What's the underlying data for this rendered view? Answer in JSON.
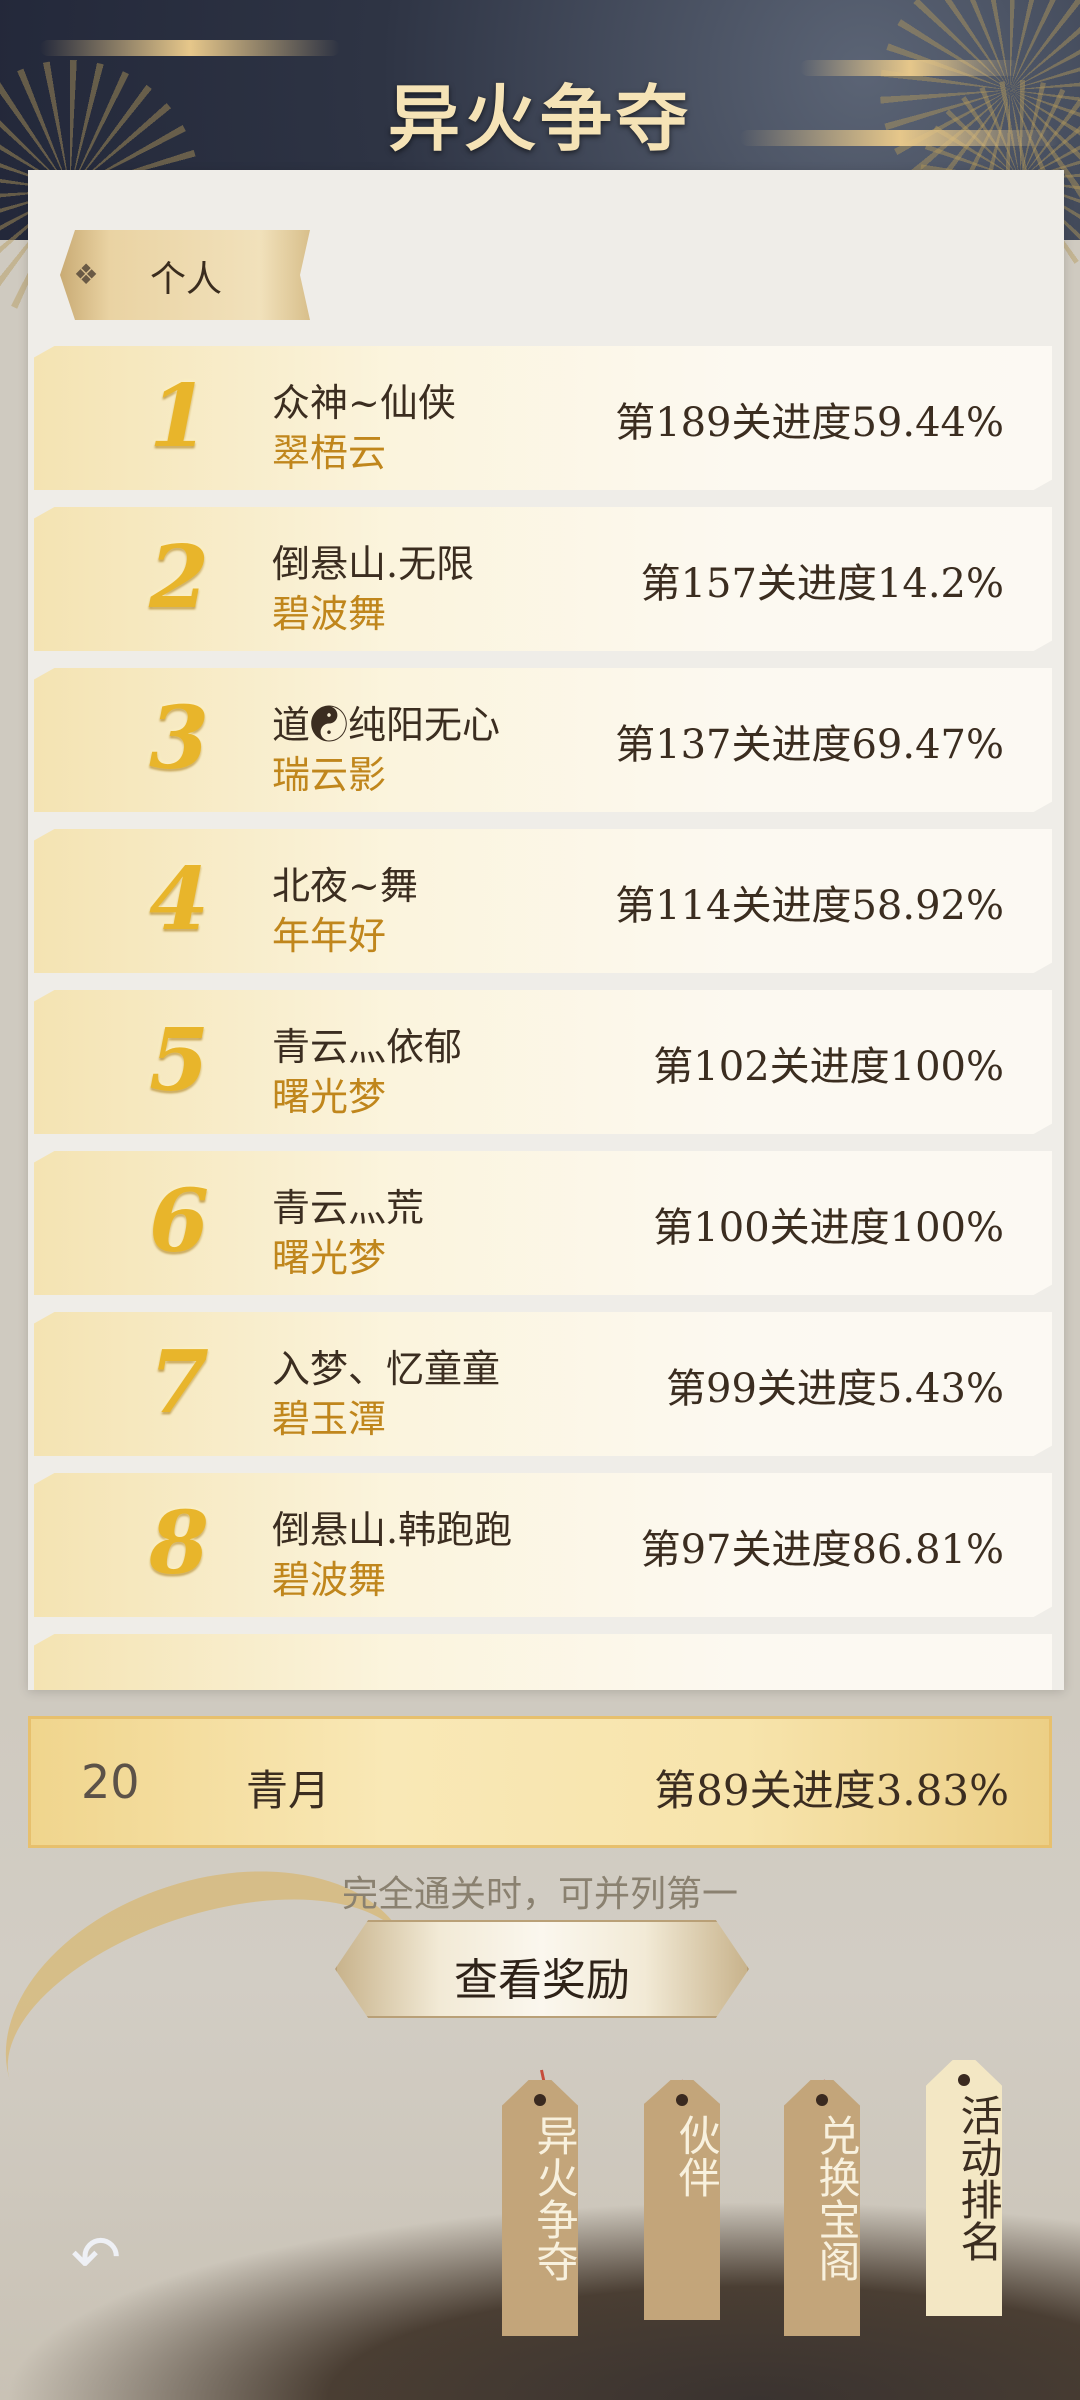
{
  "header": {
    "title": "异火争夺"
  },
  "tab": {
    "label": "个人"
  },
  "rankings": [
    {
      "rank": "1",
      "player": "众神~仙侠",
      "server": "翠梧云",
      "progress": "第189关进度59.44%"
    },
    {
      "rank": "2",
      "player": "倒悬山.无限",
      "server": "碧波舞",
      "progress": "第157关进度14.2%"
    },
    {
      "rank": "3",
      "player": "道☯纯阳无心",
      "server": "瑞云影",
      "progress": "第137关进度69.47%"
    },
    {
      "rank": "4",
      "player": "北夜~舞",
      "server": "年年好",
      "progress": "第114关进度58.92%"
    },
    {
      "rank": "5",
      "player": "青云灬依郁",
      "server": "曙光梦",
      "progress": "第102关进度100%"
    },
    {
      "rank": "6",
      "player": "青云灬荒",
      "server": "曙光梦",
      "progress": "第100关进度100%"
    },
    {
      "rank": "7",
      "player": "入梦、忆童童",
      "server": "碧玉潭",
      "progress": "第99关进度5.43%"
    },
    {
      "rank": "8",
      "player": "倒悬山.韩跑跑",
      "server": "碧波舞",
      "progress": "第97关进度86.81%"
    }
  ],
  "my_rank": {
    "rank": "20",
    "name": "青月",
    "progress": "第89关进度3.83%"
  },
  "note": "完全通关时，可并列第一",
  "reward_button": "查看奖励",
  "bottom_tabs": [
    {
      "label": "异火争夺",
      "active": false
    },
    {
      "label": "伙伴",
      "active": false
    },
    {
      "label": "兑换宝阁",
      "active": false
    },
    {
      "label": "活动排名",
      "active": true
    }
  ],
  "icons": {
    "back": "back-arrow-icon",
    "tab": "diamond-icon"
  }
}
